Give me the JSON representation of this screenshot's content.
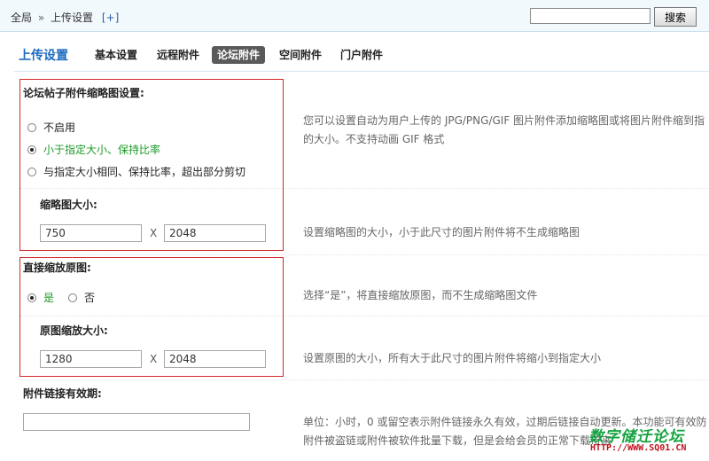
{
  "header": {
    "breadcrumb_root": "全局",
    "breadcrumb_sep": "»",
    "breadcrumb_current": "上传设置",
    "add_link": "[+]",
    "search_value": "",
    "search_button": "搜索"
  },
  "page_title": "上传设置",
  "tabs": [
    {
      "label": "基本设置",
      "active": false
    },
    {
      "label": "远程附件",
      "active": false
    },
    {
      "label": "论坛附件",
      "active": true
    },
    {
      "label": "空间附件",
      "active": false
    },
    {
      "label": "门户附件",
      "active": false
    }
  ],
  "thumb": {
    "title": "论坛帖子附件缩略图设置:",
    "options": [
      {
        "label": "不启用",
        "selected": false
      },
      {
        "label": "小于指定大小、保持比率",
        "selected": true
      },
      {
        "label": "与指定大小相同、保持比率，超出部分剪切",
        "selected": false
      }
    ],
    "tip_line1": "您可以设置自动为用户上传的 JPG/PNG/GIF 图片附件添加缩略图或将图片附件缩到指",
    "tip_line2": "的大小。不支持动画 GIF 格式"
  },
  "thumb_size": {
    "title": "缩略图大小:",
    "width": "750",
    "separator": "X",
    "height": "2048",
    "tip": "设置缩略图的大小，小于此尺寸的图片附件将不生成缩略图"
  },
  "direct": {
    "title": "直接缩放原图:",
    "yes": "是",
    "no": "否",
    "selected": "是",
    "tip": "选择“是”，将直接缩放原图，而不生成缩略图文件"
  },
  "original_size": {
    "title": "原图缩放大小:",
    "width": "1280",
    "separator": "X",
    "height": "2048",
    "tip": "设置原图的大小，所有大于此尺寸的图片附件将缩小到指定大小"
  },
  "link_expire": {
    "title": "附件链接有效期:",
    "value": "",
    "tip_line1": "单位：小时，0 或留空表示附件链接永久有效，过期后链接自动更新。本功能可有效防",
    "tip_line2": "附件被盗链或附件被软件批量下载，但是会给会员的正常下载带来"
  },
  "watermark": {
    "title": "数字储迁论坛",
    "url": "HTTP://WWW.SQ01.CN"
  },
  "colors": {
    "highlight_red": "#d4282b",
    "selected_green": "#1e9b2a",
    "title_blue": "#1d6bbf"
  }
}
